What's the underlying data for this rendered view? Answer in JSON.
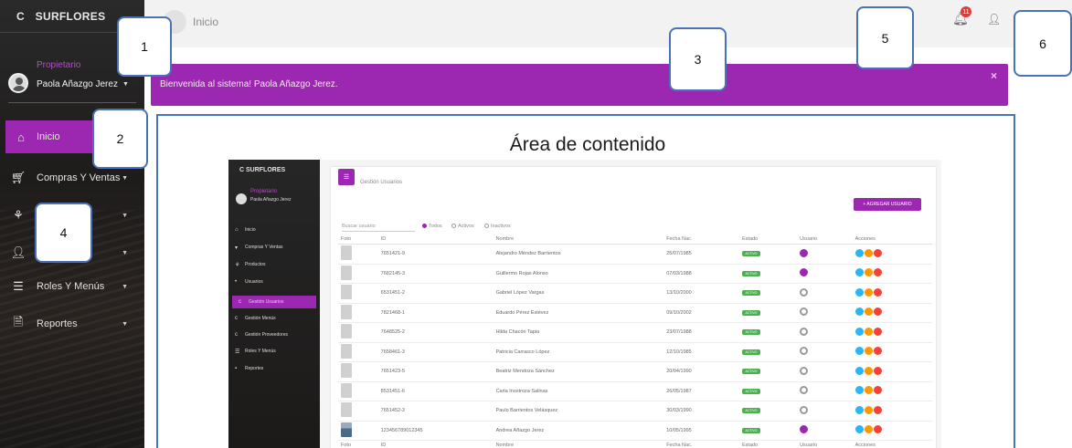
{
  "sidebar": {
    "logo": "C",
    "brand": "SURFLORES",
    "user_role": "Propietario",
    "user_name": "Paola Añazgo Jerez",
    "items": [
      {
        "label": "Inicio",
        "icon": "home-icon"
      },
      {
        "label": "Compras Y Ventas",
        "icon": "cart-icon"
      },
      {
        "label": "",
        "icon": "flower-icon"
      },
      {
        "label": "",
        "icon": "user-icon"
      },
      {
        "label": "Roles Y Menús",
        "icon": "menu-lines-icon"
      },
      {
        "label": "Reportes",
        "icon": "document-icon"
      }
    ]
  },
  "topbar": {
    "title": "Inicio",
    "notification_count": "11"
  },
  "banner": {
    "text": "Bienvenida al sistema! Paola Añazgo Jerez.",
    "close": "×"
  },
  "content": {
    "title": "Área de contenido"
  },
  "mini": {
    "brand": "C  SURFLORES",
    "role": "Propietario",
    "user": "Paola Añazgo Jerez",
    "nav": [
      {
        "label": "Inicio",
        "icon": "home-icon"
      },
      {
        "label": "Compras Y Ventas",
        "icon": "cart-icon"
      },
      {
        "label": "Productos",
        "icon": "flower-icon"
      },
      {
        "label": "Usuarios",
        "icon": "user-icon"
      },
      {
        "label": "Gestión Usuarios",
        "icon": "gear-icon",
        "active": true
      },
      {
        "label": "Gestión Menús",
        "icon": "gear-icon"
      },
      {
        "label": "Gestión Proveedores",
        "icon": "gear-icon"
      },
      {
        "label": "Roles Y Menús",
        "icon": "menu-lines-icon"
      },
      {
        "label": "Reportes",
        "icon": "document-icon"
      }
    ],
    "header_title": "Gestión Usuarios",
    "add_button": "+ AGREGAR USUARIO",
    "search_placeholder": "Buscar usuario",
    "filters": [
      "Todos",
      "Activos",
      "Inactivos"
    ],
    "columns": [
      "Foto",
      "ID",
      "Nombre",
      "Fecha Nac.",
      "Estado",
      "Usuario",
      "Acciones"
    ],
    "rows": [
      {
        "id": "7651421-9",
        "name": "Alejandro Méndez Barrientos",
        "date": "25/07/1985",
        "state": "ACTIVO",
        "user_active": true,
        "real_photo": false
      },
      {
        "id": "7682145-3",
        "name": "Guillermo Rojas Alonso",
        "date": "07/03/1988",
        "state": "ACTIVO",
        "user_active": true,
        "real_photo": false
      },
      {
        "id": "6531451-2",
        "name": "Gabriel López Vargas",
        "date": "13/10/2000",
        "state": "ACTIVO",
        "user_active": false,
        "real_photo": false
      },
      {
        "id": "7821468-1",
        "name": "Eduardo Pérez Estévez",
        "date": "09/10/2002",
        "state": "ACTIVO",
        "user_active": false,
        "real_photo": false
      },
      {
        "id": "7648525-2",
        "name": "Hilda Chacón Tapia",
        "date": "23/07/1988",
        "state": "ACTIVO",
        "user_active": false,
        "real_photo": false
      },
      {
        "id": "7658461-3",
        "name": "Patricia Carrasco López",
        "date": "12/10/1985",
        "state": "ACTIVO",
        "user_active": false,
        "real_photo": false
      },
      {
        "id": "7651423-5",
        "name": "Beatriz Mendoza Sánchez",
        "date": "20/04/1990",
        "state": "ACTIVO",
        "user_active": false,
        "real_photo": false
      },
      {
        "id": "8531451-6",
        "name": "Carla Inostroza Salinas",
        "date": "26/05/1987",
        "state": "ACTIVO",
        "user_active": false,
        "real_photo": false
      },
      {
        "id": "7651452-3",
        "name": "Paulo Barrientos Velásquez",
        "date": "30/03/1990",
        "state": "ACTIVO",
        "user_active": false,
        "real_photo": false
      },
      {
        "id": "123456789012345",
        "name": "Andrea Añazgo Jerez",
        "date": "10/05/1995",
        "state": "ACTIVO",
        "user_active": true,
        "real_photo": true
      }
    ],
    "footer": [
      "Foto",
      "ID",
      "Nombre",
      "Fecha Nac.",
      "Estado",
      "Usuario",
      "Acciones"
    ]
  },
  "callouts": [
    "1",
    "2",
    "3",
    "4",
    "5",
    "6"
  ],
  "colors": {
    "accent": "#9c27b0",
    "callout_border": "#4a72b8",
    "badge_red": "#e53935",
    "status_green": "#4caf50"
  }
}
